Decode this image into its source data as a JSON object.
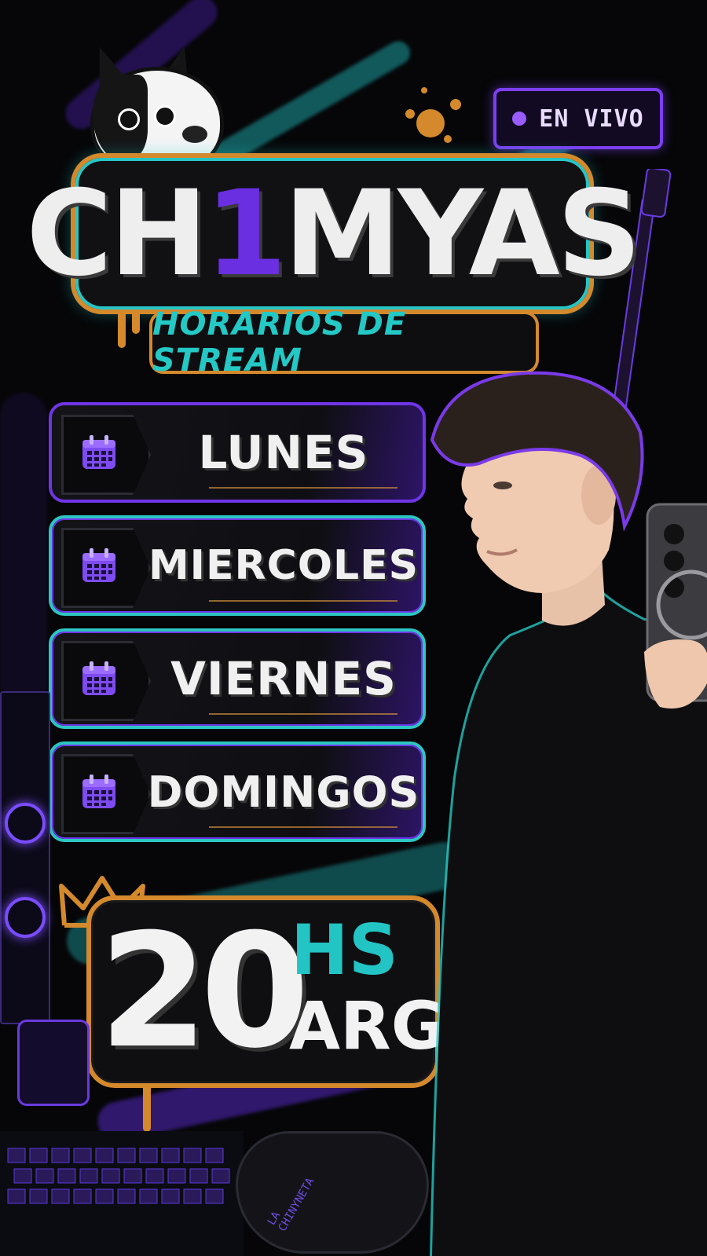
{
  "live_badge": {
    "label": "EN VIVO"
  },
  "header": {
    "title_prefix": "CH",
    "title_accent": "1",
    "title_suffix": "MYAS",
    "subtitle": "HORARIOS DE STREAM"
  },
  "schedule": {
    "days": [
      "LUNES",
      "MIERCOLES",
      "VIERNES",
      "DOMINGOS"
    ]
  },
  "time": {
    "number": "20",
    "unit": "HS",
    "zone": "ARG"
  },
  "controller_text": "LA CHINYNETA",
  "colors": {
    "purple": "#6f35e6",
    "teal": "#26c6c6",
    "orange": "#d4892c",
    "background": "#060608"
  },
  "icons": [
    "calendar-icon",
    "crown-icon",
    "live-dot-icon",
    "dog-mascot",
    "guitar",
    "phone"
  ]
}
